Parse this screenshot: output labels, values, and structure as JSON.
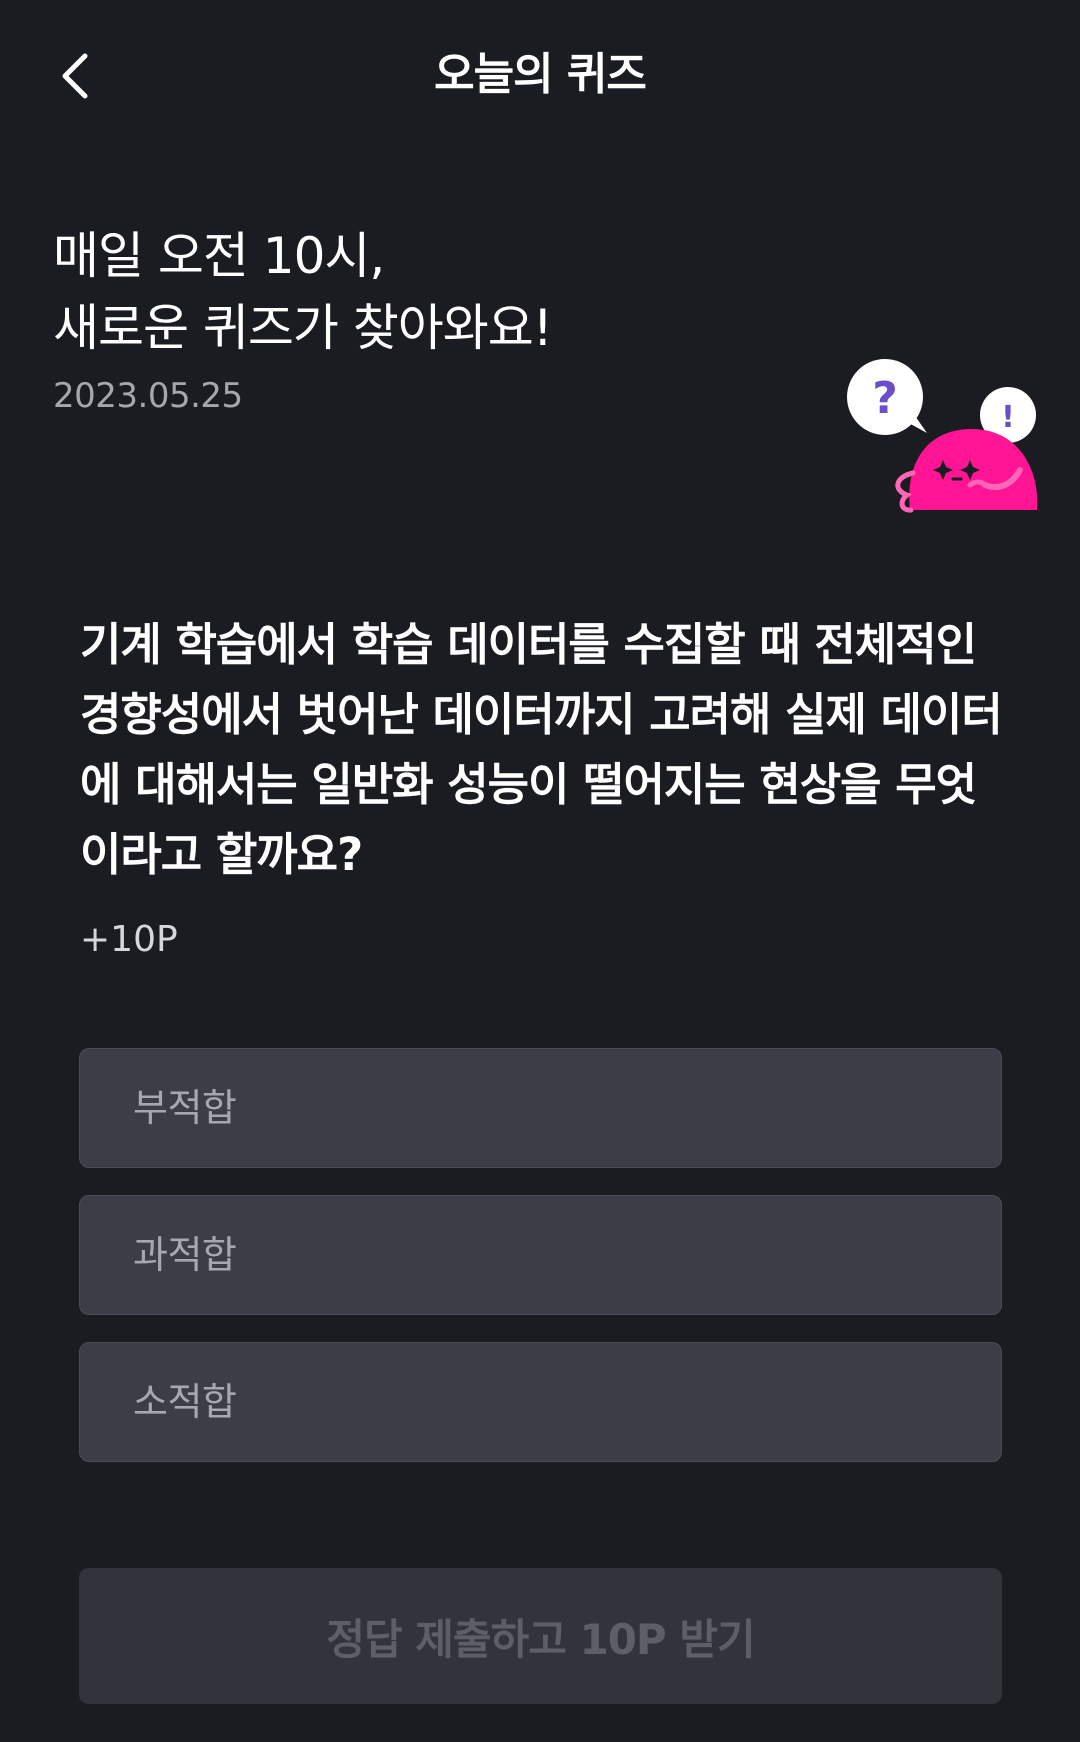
{
  "header": {
    "title": "오늘의 퀴즈",
    "back_icon": "chevron-left-icon"
  },
  "intro": {
    "line1": "매일 오전 10시,",
    "line2": "새로운 퀴즈가 찾아와요!",
    "date": "2023.05.25"
  },
  "mascot": {
    "question_mark": "?",
    "exclamation_mark": "!",
    "color": "#ff1493",
    "bubble_accent": "#6a4fc9"
  },
  "quiz": {
    "question": "기계 학습에서 학습 데이터를 수집할 때 전체적인 경향성에서 벗어난 데이터까지 고려해 실제 데이터에 대해서는 일반화 성능이 떨어지는 현상을 무엇이라고 할까요?",
    "points": "+10P",
    "options": [
      {
        "label": "부적합"
      },
      {
        "label": "과적합"
      },
      {
        "label": "소적합"
      }
    ]
  },
  "submit": {
    "label": "정답 제출하고 10P 받기"
  },
  "colors": {
    "background": "#1b1c21",
    "option_bg": "#3b3e47",
    "submit_bg": "#32343b",
    "submit_text": "#5c5f67"
  }
}
